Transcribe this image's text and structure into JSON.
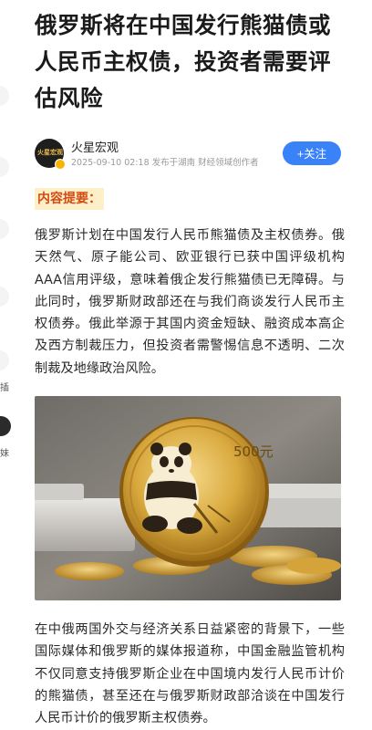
{
  "article": {
    "title": "俄罗斯将在中国发行熊猫债或人民币主权债，投资者需要评估风险",
    "author": {
      "name": "火星宏观",
      "avatar_text": "火星宏观",
      "meta": "2025-09-10 02:18 发布于湖南 财经领域创作者"
    },
    "follow_label": "+关注",
    "summary_label": "内容提要：",
    "paragraph1": "俄罗斯计划在中国发行人民币熊猫债及主权债券。俄天然气、原子能公司、欧亚银行已获中国评级机构AAA信用评级，意味着俄企发行熊猫债已无障碍。与此同时，俄罗斯财政部还在与我们商谈发行人民币主权债券。俄此举源于其国内资金短缺、融资成本高企及西方制裁压力，但投资者需警惕信息不透明、二次制裁及地缘政治风险。",
    "image": {
      "coin_text": "500元",
      "icon": "panda-gold-coin-image"
    },
    "paragraph2": "在中俄两国外交与经济关系日益紧密的背景下，一些国际媒体和俄罗斯的媒体报道称，中国金融监管机构不仅同意支持俄罗斯企业在中国境内发行人民币计价的熊猫债，甚至还在与俄罗斯财政部洽谈在中国发行人民币计价的俄罗斯主权债券。"
  },
  "sidebar": {
    "glyphs": [
      "插",
      "妹"
    ]
  },
  "colors": {
    "accent": "#3a82f7",
    "summary_bg": "#fdf0c8",
    "summary_text": "#d44a13",
    "meta_gray": "#9a9a9a"
  }
}
